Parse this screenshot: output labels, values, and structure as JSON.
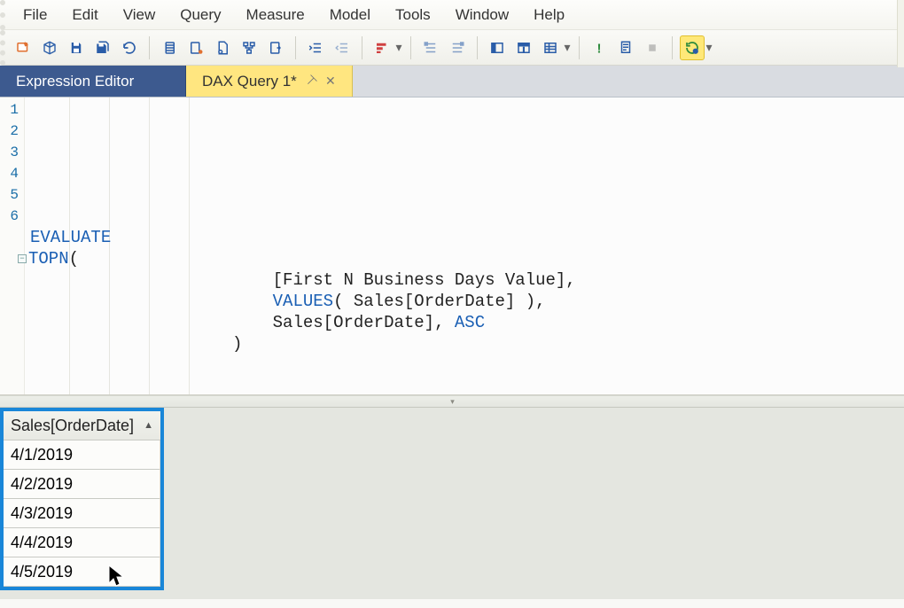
{
  "menu": {
    "items": [
      "File",
      "Edit",
      "View",
      "Query",
      "Measure",
      "Model",
      "Tools",
      "Window",
      "Help"
    ]
  },
  "toolbar": {
    "icons": [
      "new-connection",
      "cube",
      "save",
      "save-all",
      "refresh",
      "copy",
      "paste-special",
      "page",
      "tree",
      "export",
      "indent",
      "outdent",
      "format-dax",
      "align-left",
      "align-right",
      "panel-left",
      "panel-bottom",
      "panel-grid",
      "exclaim",
      "doc-check",
      "stop",
      "run-gear"
    ]
  },
  "tabs": {
    "items": [
      {
        "label": "Expression Editor",
        "active": false,
        "pinned": false,
        "closable": false
      },
      {
        "label": "DAX Query 1*",
        "active": true,
        "pinned": true,
        "closable": true
      }
    ]
  },
  "editor": {
    "lines": [
      {
        "n": 1,
        "segments": [
          {
            "t": "EVALUATE",
            "c": "kw"
          }
        ],
        "indent": 0
      },
      {
        "n": 2,
        "segments": [
          {
            "t": "TOPN",
            "c": "fn"
          },
          {
            "t": "(",
            "c": ""
          }
        ],
        "indent": 0,
        "fold": true
      },
      {
        "n": 3,
        "segments": [
          {
            "t": "[First N Business Days Value],",
            "c": ""
          }
        ],
        "indent": 24
      },
      {
        "n": 4,
        "segments": [
          {
            "t": "VALUES",
            "c": "fn"
          },
          {
            "t": "( Sales[OrderDate] ),",
            "c": ""
          }
        ],
        "indent": 24
      },
      {
        "n": 5,
        "segments": [
          {
            "t": "Sales[OrderDate], ",
            "c": ""
          },
          {
            "t": "ASC",
            "c": "asc"
          }
        ],
        "indent": 24
      },
      {
        "n": 6,
        "segments": [
          {
            "t": ")",
            "c": ""
          }
        ],
        "indent": 20
      }
    ]
  },
  "results": {
    "header": "Sales[OrderDate]",
    "sorted": "asc",
    "rows": [
      "4/1/2019",
      "4/2/2019",
      "4/3/2019",
      "4/4/2019",
      "4/5/2019"
    ]
  }
}
